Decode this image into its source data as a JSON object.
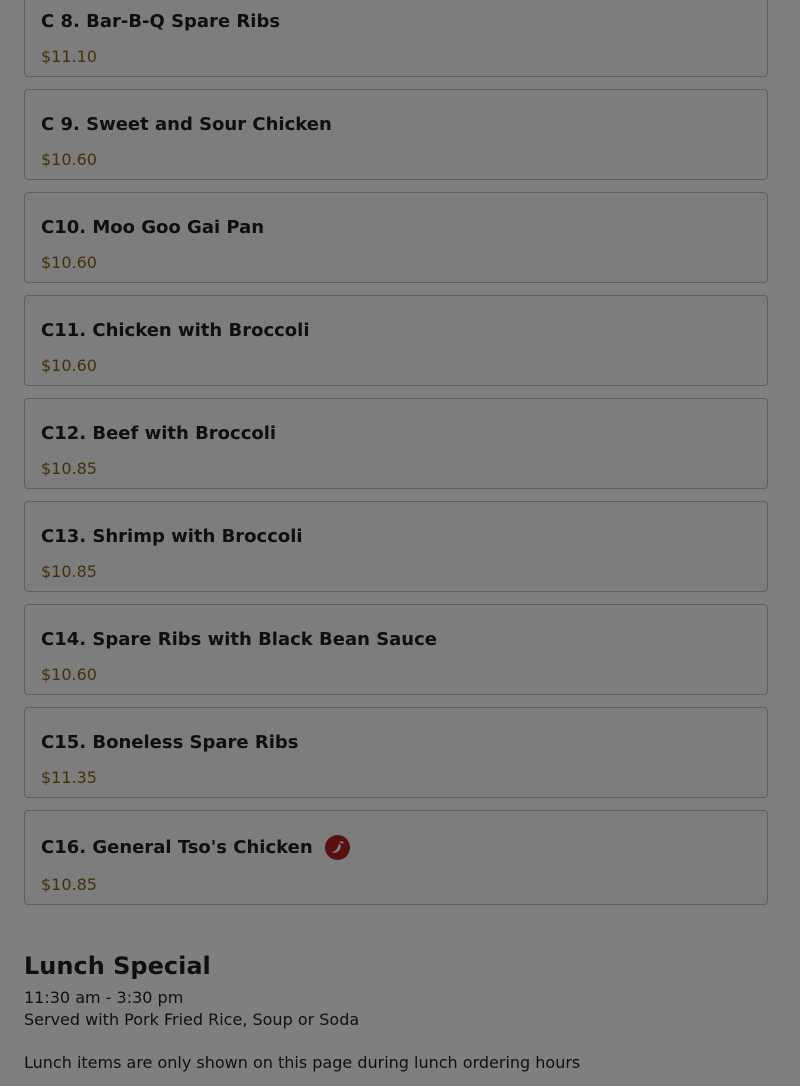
{
  "menu_items": [
    {
      "name": "C 8. Bar-B-Q Spare Ribs",
      "price": "$11.10"
    },
    {
      "name": "C 9. Sweet and Sour Chicken",
      "price": "$10.60"
    },
    {
      "name": "C10. Moo Goo Gai Pan",
      "price": "$10.60"
    },
    {
      "name": "C11. Chicken with Broccoli",
      "price": "$10.60"
    },
    {
      "name": "C12. Beef with Broccoli",
      "price": "$10.85"
    },
    {
      "name": "C13. Shrimp with Broccoli",
      "price": "$10.85"
    },
    {
      "name": "C14. Spare Ribs with Black Bean Sauce",
      "price": "$10.60"
    },
    {
      "name": "C15. Boneless Spare Ribs",
      "price": "$11.35"
    },
    {
      "name": "C16. General Tso's Chicken",
      "price": "$10.85",
      "icon": "spicy-pepper-icon"
    }
  ],
  "lunch_special": {
    "title": "Lunch Special",
    "hours": "11:30 am - 3:30 pm",
    "description": "Served with Pork Fried Rice, Soup or Soda",
    "note": "Lunch items are only shown on this page during lunch ordering hours"
  },
  "colors": {
    "price": "#8a6212",
    "spicy_icon": "#b0231d",
    "overlay": "rgba(0,0,0,0.5)"
  }
}
